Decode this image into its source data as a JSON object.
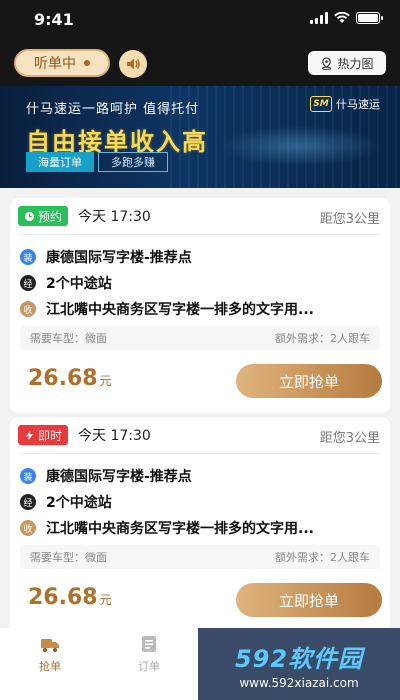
{
  "status_bar": {
    "time": "9:41"
  },
  "header": {
    "listening_label": "听单中",
    "heatmap_label": "热力图"
  },
  "banner": {
    "tagline": "什马速运一路呵护   值得托付",
    "headline": "自由接单收入高",
    "chip_primary": "海量订单",
    "chip_secondary": "多跑多赚",
    "logo_badge": "SM",
    "logo_text": "什马速运"
  },
  "orders": [
    {
      "type_label": "预约",
      "type_color": "#2bbf5a",
      "time": "今天 17:30",
      "distance": "距您3公里",
      "stops": [
        {
          "marker": "装",
          "text": "康德国际写字楼-推荐点"
        },
        {
          "marker": "经",
          "text": "2个中途站"
        },
        {
          "marker": "收",
          "text": "江北嘴中央商务区写字楼一排多的文字用..."
        }
      ],
      "vehicle_req": "需要车型：微面",
      "extra_req": "额外需求：2人跟车",
      "price": "26.68",
      "price_unit": "元",
      "action_label": "立即抢单"
    },
    {
      "type_label": "即时",
      "type_color": "#e83a3a",
      "time": "今天 17:30",
      "distance": "距您3公里",
      "stops": [
        {
          "marker": "装",
          "text": "康德国际写字楼-推荐点"
        },
        {
          "marker": "经",
          "text": "2个中途站"
        },
        {
          "marker": "收",
          "text": "江北嘴中央商务区写字楼一排多的文字用..."
        }
      ],
      "vehicle_req": "需要车型：微面",
      "extra_req": "额外需求：2人跟车",
      "price": "26.68",
      "price_unit": "元",
      "action_label": "立即抢单"
    }
  ],
  "tabbar": {
    "tabs": [
      {
        "label": "抢单",
        "icon": "truck-icon",
        "active": true
      },
      {
        "label": "订单",
        "icon": "document-icon",
        "active": false
      }
    ]
  },
  "watermark": {
    "title": "592软件园",
    "url": "www.592xiazai.com"
  },
  "colors": {
    "accent": "#b0702b",
    "header_bg": "#161616"
  }
}
